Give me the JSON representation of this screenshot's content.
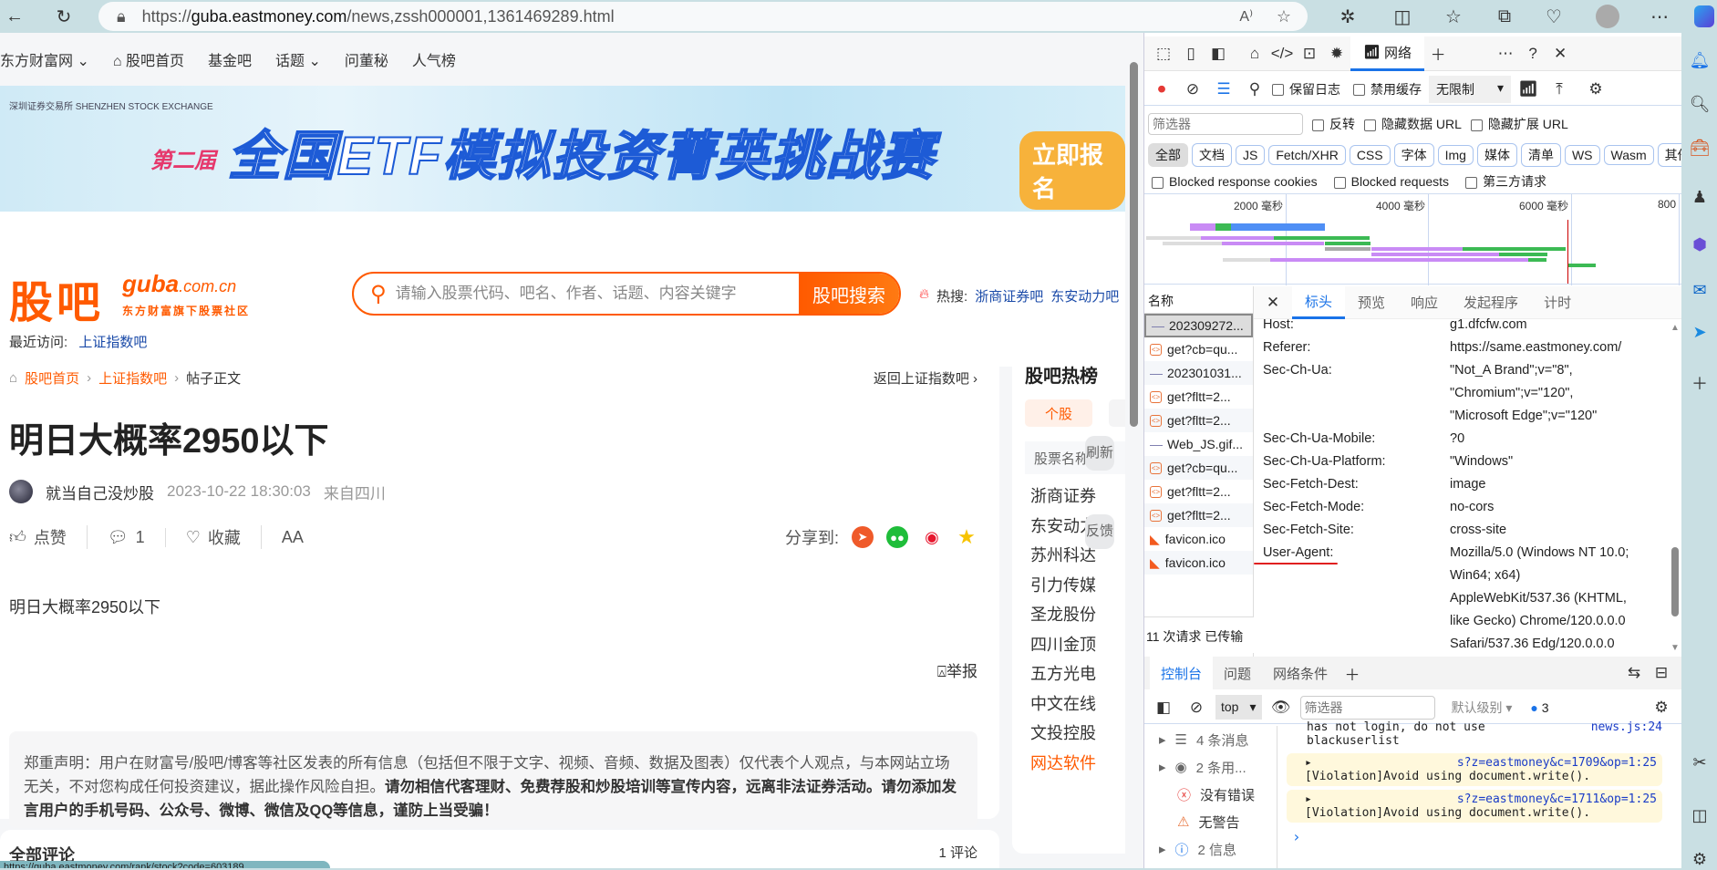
{
  "browser": {
    "url_prefix": "https://",
    "url_host": "guba.eastmoney.com",
    "url_path": "/news,zssh000001,1361469289.html",
    "status_url": "https://guba.eastmoney.com/rank/stock?code=603189"
  },
  "nav": {
    "items": [
      "东方财富网",
      "股吧首页",
      "基金吧",
      "话题",
      "问董秘",
      "人气榜"
    ]
  },
  "banner": {
    "edition": "第二届",
    "title": "全国ETF模拟投资菁英挑战赛",
    "cta": "立即报名",
    "sponsor": "深圳证券交易所 SHENZHEN STOCK EXCHANGE"
  },
  "header": {
    "logo_cn": "股吧",
    "logo_en": "guba",
    "logo_domain": ".com.cn",
    "logo_slogan": "东方财富旗下股票社区",
    "search_placeholder": "请输入股票代码、吧名、作者、话题、内容关键字",
    "search_button": "股吧搜索",
    "hot_label": "热搜:",
    "hot_items": [
      "浙商证券吧",
      "东安动力吧"
    ],
    "recent_label": "最近访问:",
    "recent_item": "上证指数吧"
  },
  "post": {
    "breadcrumb": [
      "股吧首页",
      "上证指数吧",
      "帖子正文"
    ],
    "back_link": "返回上证指数吧",
    "title": "明日大概率2950以下",
    "author": "就当自己没炒股",
    "time": "2023-10-22 18:30:03",
    "location": "来自四川",
    "like": "点赞",
    "comments": "1",
    "favorite": "收藏",
    "font": "AA",
    "share_label": "分享到:",
    "body": "明日大概率2950以下",
    "report": "举报",
    "disclaimer_plain": "郑重声明：用户在财富号/股吧/博客等社区发表的所有信息（包括但不限于文字、视频、音频、数据及图表）仅代表个人观点，与本网站立场无关，不对您构成任何投资建议，据此操作风险自担。",
    "disclaimer_bold": "请勿相信代客理财、免费荐股和炒股培训等宣传内容，远离非法证券活动。请勿添加发言用户的手机号码、公众号、微博、微信及QQ等信息，谨防上当受骗！",
    "comments_partial": "全部评论",
    "comment_count_partial": "1 评论"
  },
  "hot_list": {
    "title": "股吧热榜",
    "tab": "个股",
    "col": "股票名称",
    "items": [
      "浙商证券",
      "东安动力",
      "苏州科达",
      "引力传媒",
      "圣龙股份",
      "四川金顶",
      "五方光电",
      "中文在线",
      "文投控股",
      "网达软件"
    ],
    "refresh": "刷新",
    "feedback": "反馈"
  },
  "devtools": {
    "active_tab": "网络",
    "toolbar2": {
      "preserve_log": "保留日志",
      "disable_cache": "禁用缓存",
      "throttle": "无限制"
    },
    "filter_placeholder": "筛选器",
    "invert": "反转",
    "hide_data_url": "隐藏数据 URL",
    "hide_ext_url": "隐藏扩展 URL",
    "types": [
      "全部",
      "文档",
      "JS",
      "Fetch/XHR",
      "CSS",
      "字体",
      "Img",
      "媒体",
      "清单",
      "WS",
      "Wasm",
      "其他"
    ],
    "blocked_cookies": "Blocked response cookies",
    "blocked_requests": "Blocked requests",
    "third_party": "第三方请求",
    "timeline_ticks": [
      "2000 毫秒",
      "4000 毫秒",
      "6000 毫秒",
      "800"
    ],
    "name_header": "名称",
    "requests": [
      "202309272...",
      "get?cb=qu...",
      "202301031...",
      "get?fltt=2...",
      "get?fltt=2...",
      "Web_JS.gif...",
      "get?cb=qu...",
      "get?fltt=2...",
      "get?fltt=2...",
      "favicon.ico",
      "favicon.ico"
    ],
    "summary": "11 次请求  已传输",
    "detail_tabs": [
      "标头",
      "预览",
      "响应",
      "发起程序",
      "计时"
    ],
    "headers": [
      {
        "k": "Host:",
        "v": [
          "g1.dfcfw.com"
        ]
      },
      {
        "k": "Referer:",
        "v": [
          "https://same.eastmoney.com/"
        ]
      },
      {
        "k": "Sec-Ch-Ua:",
        "v": [
          "\"Not_A Brand\";v=\"8\",",
          "\"Chromium\";v=\"120\",",
          "\"Microsoft Edge\";v=\"120\""
        ]
      },
      {
        "k": "Sec-Ch-Ua-Mobile:",
        "v": [
          "?0"
        ]
      },
      {
        "k": "Sec-Ch-Ua-Platform:",
        "v": [
          "\"Windows\""
        ]
      },
      {
        "k": "Sec-Fetch-Dest:",
        "v": [
          "image"
        ]
      },
      {
        "k": "Sec-Fetch-Mode:",
        "v": [
          "no-cors"
        ]
      },
      {
        "k": "Sec-Fetch-Site:",
        "v": [
          "cross-site"
        ]
      },
      {
        "k": "User-Agent:",
        "v": [
          "Mozilla/5.0 (Windows NT 10.0;",
          "Win64; x64)",
          "AppleWebKit/537.36 (KHTML,",
          "like Gecko) Chrome/120.0.0.0",
          "Safari/537.36 Edg/120.0.0.0"
        ]
      }
    ],
    "drawer_tabs": [
      "控制台",
      "问题",
      "网络条件"
    ],
    "console": {
      "context": "top",
      "filter_placeholder": "筛选器",
      "level": "默认级别",
      "issues": "3",
      "sidebar": [
        "4 条消息",
        "2 条用...",
        "没有错误",
        "无警告",
        "2 信息"
      ],
      "partial_line": "has not login, do not use",
      "partial_src": "news.js:24",
      "partial_line2": "blackuserlist",
      "messages": [
        {
          "src": "s?z=eastmoney&c=1709&op=1:25",
          "text": "[Violation]Avoid using document.write()."
        },
        {
          "src": "s?z=eastmoney&c=1711&op=1:25",
          "text": "[Violation]Avoid using document.write()."
        }
      ]
    }
  },
  "colors": {
    "brand": "#ff5a00",
    "link": "#1a4aa8",
    "devtools_accent": "#1a73e8",
    "annotation": "#e02020"
  }
}
